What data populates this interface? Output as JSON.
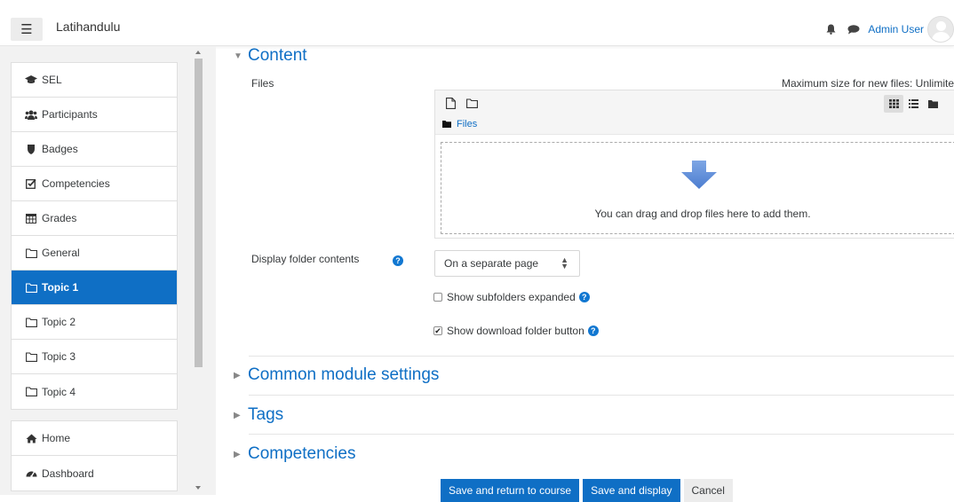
{
  "navbar": {
    "site_name": "Latihandulu",
    "user_name": "Admin User"
  },
  "drawer": {
    "items": [
      {
        "label": "SEL",
        "icon": "graduation-cap-icon"
      },
      {
        "label": "Participants",
        "icon": "users-icon"
      },
      {
        "label": "Badges",
        "icon": "shield-icon"
      },
      {
        "label": "Competencies",
        "icon": "check-square-icon"
      },
      {
        "label": "Grades",
        "icon": "table-icon"
      },
      {
        "label": "General",
        "icon": "folder-icon"
      },
      {
        "label": "Topic 1",
        "icon": "folder-icon",
        "active": true
      },
      {
        "label": "Topic 2",
        "icon": "folder-icon"
      },
      {
        "label": "Topic 3",
        "icon": "folder-icon"
      },
      {
        "label": "Topic 4",
        "icon": "folder-icon"
      }
    ],
    "bottom_items": [
      {
        "label": "Home",
        "icon": "home-icon"
      },
      {
        "label": "Dashboard",
        "icon": "dashboard-icon"
      }
    ]
  },
  "content": {
    "section_title": "Content",
    "files_label": "Files",
    "max_size": "Maximum size for new files: Unlimite",
    "path_label": "Files",
    "dropzone_text": "You can drag and drop files here to add them.",
    "display_label": "Display folder contents",
    "display_value": "On a separate page",
    "show_subfolders_label": "Show subfolders expanded",
    "show_subfolders_checked": false,
    "show_download_label": "Show download folder button",
    "show_download_checked": true
  },
  "sections": {
    "common": "Common module settings",
    "tags": "Tags",
    "competencies": "Competencies"
  },
  "buttons": {
    "save_return": "Save and return to course",
    "save_display": "Save and display",
    "cancel": "Cancel"
  },
  "colors": {
    "accent": "#0f6fc5"
  }
}
